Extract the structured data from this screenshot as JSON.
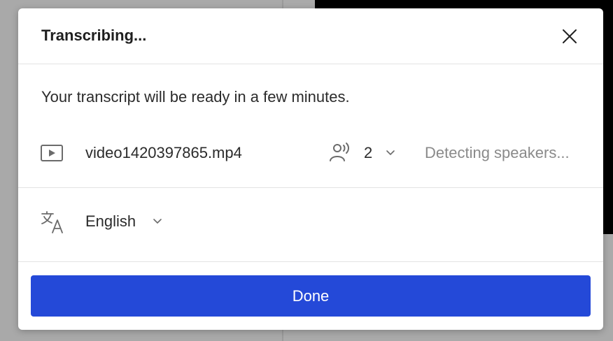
{
  "dialog": {
    "title": "Transcribing...",
    "subtitle": "Your transcript will be ready in a few minutes."
  },
  "file": {
    "name": "video1420397865.mp4",
    "icon": "video-icon",
    "speaker_icon": "speakers-icon",
    "speaker_count": "2",
    "status": "Detecting speakers..."
  },
  "language": {
    "icon": "translate-icon",
    "selected": "English"
  },
  "actions": {
    "done_label": "Done"
  },
  "colors": {
    "primary_button": "#2449d8",
    "status_text": "#8a8a8a"
  }
}
